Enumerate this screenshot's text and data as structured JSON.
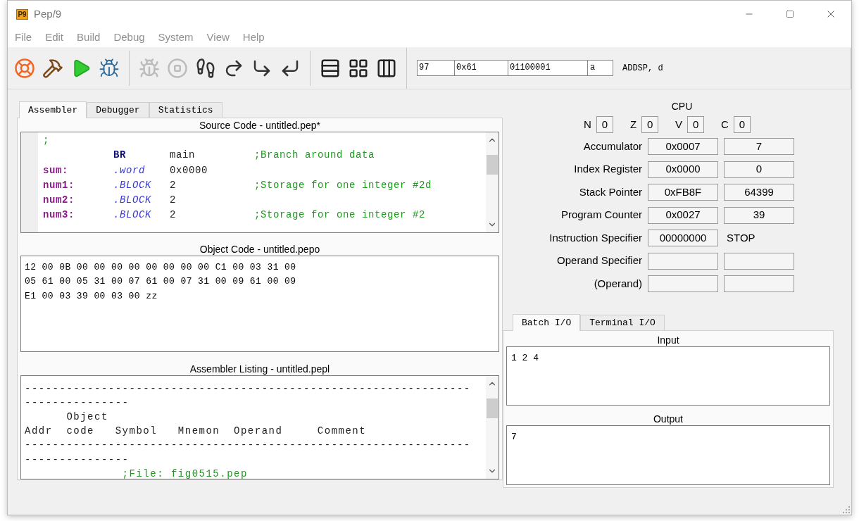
{
  "window": {
    "app_icon_text": "P9",
    "title": "Pep/9"
  },
  "menu": [
    "File",
    "Edit",
    "Build",
    "Debug",
    "System",
    "View",
    "Help"
  ],
  "toolbar": [
    {
      "kind": "help",
      "disabled": false
    },
    {
      "kind": "build",
      "disabled": false
    },
    {
      "kind": "run",
      "disabled": false
    },
    {
      "kind": "debug",
      "disabled": false
    },
    {
      "kind": "sep"
    },
    {
      "kind": "resume",
      "disabled": true
    },
    {
      "kind": "stop",
      "disabled": true
    },
    {
      "kind": "step",
      "disabled": false
    },
    {
      "kind": "step-over",
      "disabled": false
    },
    {
      "kind": "step-into",
      "disabled": false
    },
    {
      "kind": "step-out",
      "disabled": false
    },
    {
      "kind": "sep"
    },
    {
      "kind": "layout-rows",
      "disabled": false
    },
    {
      "kind": "layout-grid",
      "disabled": false
    },
    {
      "kind": "layout-cols",
      "disabled": false
    }
  ],
  "converter": {
    "decimal": "97",
    "hex": "0x61",
    "binary": "01100001",
    "char": "a",
    "instruction": "ADDSP, d"
  },
  "left_tabs": [
    {
      "label": "Assembler",
      "selected": true
    },
    {
      "label": "Debugger",
      "selected": false
    },
    {
      "label": "Statistics",
      "selected": false
    }
  ],
  "source": {
    "title": "Source Code - untitled.pep*",
    "lines": [
      {
        "kind": "comment",
        "comment": ";"
      },
      {
        "mnemonic": "BR",
        "kind": "instruction",
        "operand": "main",
        "comment": ";Branch around data"
      },
      {
        "symbol": "sum:",
        "mnemonic": ".word",
        "kind": "directive",
        "operand": "0x0000"
      },
      {
        "symbol": "num1:",
        "mnemonic": ".BLOCK",
        "kind": "directive",
        "operand": "2",
        "comment": ";Storage for one integer #2d"
      },
      {
        "symbol": "num2:",
        "mnemonic": ".BLOCK",
        "kind": "directive",
        "operand": "2"
      },
      {
        "symbol": "num3:",
        "mnemonic": ".BLOCK",
        "kind": "directive",
        "operand": "2",
        "comment": ";Storage for one integer #2"
      }
    ]
  },
  "object": {
    "title": "Object Code - untitled.pepo",
    "lines": [
      "12 00 0B 00 00 00 00 00 00 00 00 C1 00 03 31 00",
      "05 61 00 05 31 00 07 61 00 07 31 00 09 61 00 09",
      "E1 00 03 39 00 03 00 zz"
    ]
  },
  "listing": {
    "title": "Assembler Listing - untitled.pepl",
    "lines": [
      {
        "kind": "text",
        "text": "----------------------------------------------------------------"
      },
      {
        "kind": "text",
        "text": "---------------"
      },
      {
        "kind": "text",
        "text": "      Object"
      },
      {
        "kind": "text",
        "text": "Addr  code   Symbol   Mnemon  Operand     Comment"
      },
      {
        "kind": "text",
        "text": "----------------------------------------------------------------"
      },
      {
        "kind": "text",
        "text": "---------------"
      },
      {
        "kind": "comment",
        "text": "              ;File: fig0515.pep"
      }
    ]
  },
  "cpu": {
    "title": "CPU",
    "flags": [
      {
        "name": "N",
        "value": "0"
      },
      {
        "name": "Z",
        "value": "0"
      },
      {
        "name": "V",
        "value": "0"
      },
      {
        "name": "C",
        "value": "0"
      }
    ],
    "registers": [
      {
        "label": "Accumulator",
        "kind": "pair",
        "hex": "0x0007",
        "dec": "7"
      },
      {
        "label": "Index Register",
        "kind": "pair",
        "hex": "0x0000",
        "dec": "0"
      },
      {
        "label": "Stack Pointer",
        "kind": "pair",
        "hex": "0xFB8F",
        "dec": "64399"
      },
      {
        "label": "Program Counter",
        "kind": "pair",
        "hex": "0x0027",
        "dec": "39"
      },
      {
        "label": "Instruction Specifier",
        "kind": "mnemonic",
        "hex": "00000000",
        "dec": "STOP"
      },
      {
        "label": "Operand Specifier",
        "kind": "pair"
      },
      {
        "label": "(Operand)",
        "kind": "pair"
      }
    ]
  },
  "io_tabs": [
    {
      "label": "Batch I/O",
      "selected": true
    },
    {
      "label": "Terminal I/O",
      "selected": false
    }
  ],
  "io": {
    "input_title": "Input",
    "input": "1 2 4",
    "output_title": "Output",
    "output": "7"
  }
}
